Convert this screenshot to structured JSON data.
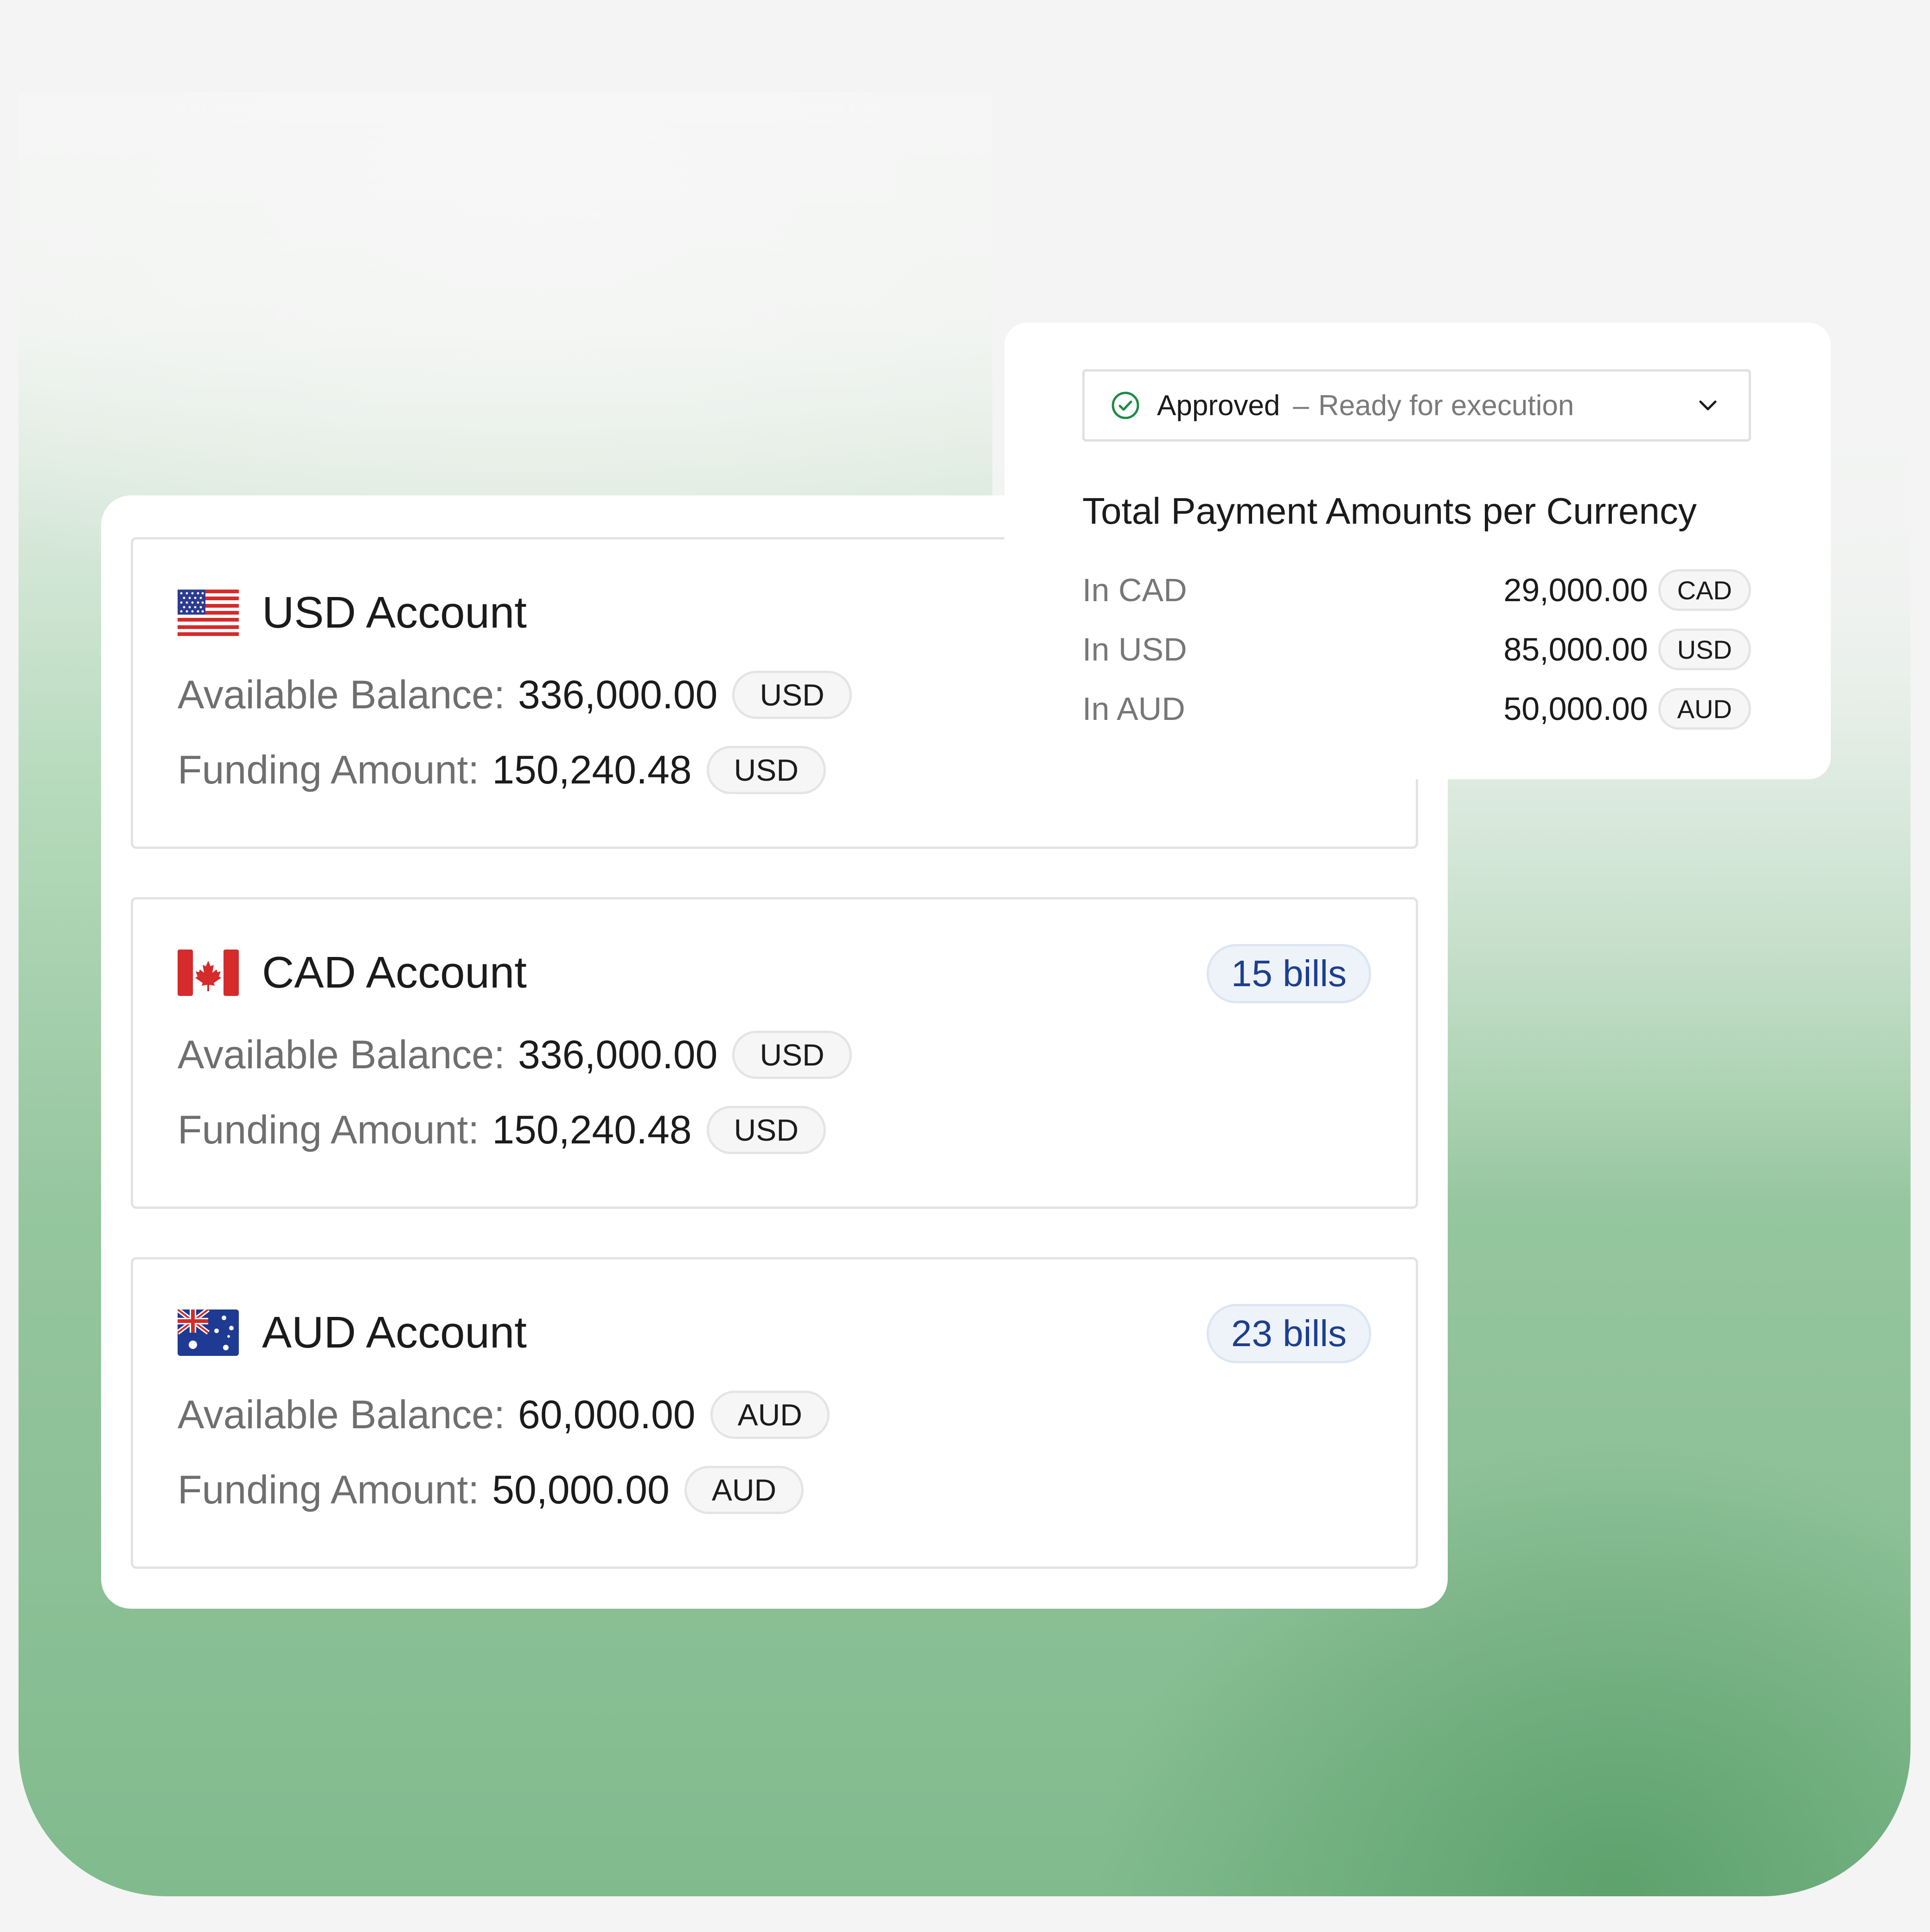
{
  "colors": {
    "bills_text": "#1d3f8f",
    "approved_icon": "#1e8a46",
    "bg_green": "#80bb8d"
  },
  "accounts": [
    {
      "flag": "us-flag-icon",
      "title": "USD Account",
      "bills": "",
      "available_label": "Available Balance:",
      "available_value": "336,000.00",
      "available_currency": "USD",
      "funding_label": "Funding Amount:",
      "funding_value": "150,240.48",
      "funding_currency": "USD"
    },
    {
      "flag": "canada-flag-icon",
      "title": "CAD Account",
      "bills": "15 bills",
      "available_label": "Available Balance:",
      "available_value": "336,000.00",
      "available_currency": "USD",
      "funding_label": "Funding Amount:",
      "funding_value": "150,240.48",
      "funding_currency": "USD"
    },
    {
      "flag": "australia-flag-icon",
      "title": "AUD Account",
      "bills": "23 bills",
      "available_label": "Available Balance:",
      "available_value": "60,000.00",
      "available_currency": "AUD",
      "funding_label": "Funding Amount:",
      "funding_value": "50,000.00",
      "funding_currency": "AUD"
    }
  ],
  "summary": {
    "status": {
      "icon": "check-circle-icon",
      "label": "Approved",
      "separator": "–",
      "sublabel": "Ready for execution",
      "chevron": "chevron-down-icon"
    },
    "title": "Total Payment Amounts per Currency",
    "rows": [
      {
        "label": "In CAD",
        "value": "29,000.00",
        "currency": "CAD"
      },
      {
        "label": "In USD",
        "value": "85,000.00",
        "currency": "USD"
      },
      {
        "label": "In AUD",
        "value": "50,000.00",
        "currency": "AUD"
      }
    ]
  }
}
